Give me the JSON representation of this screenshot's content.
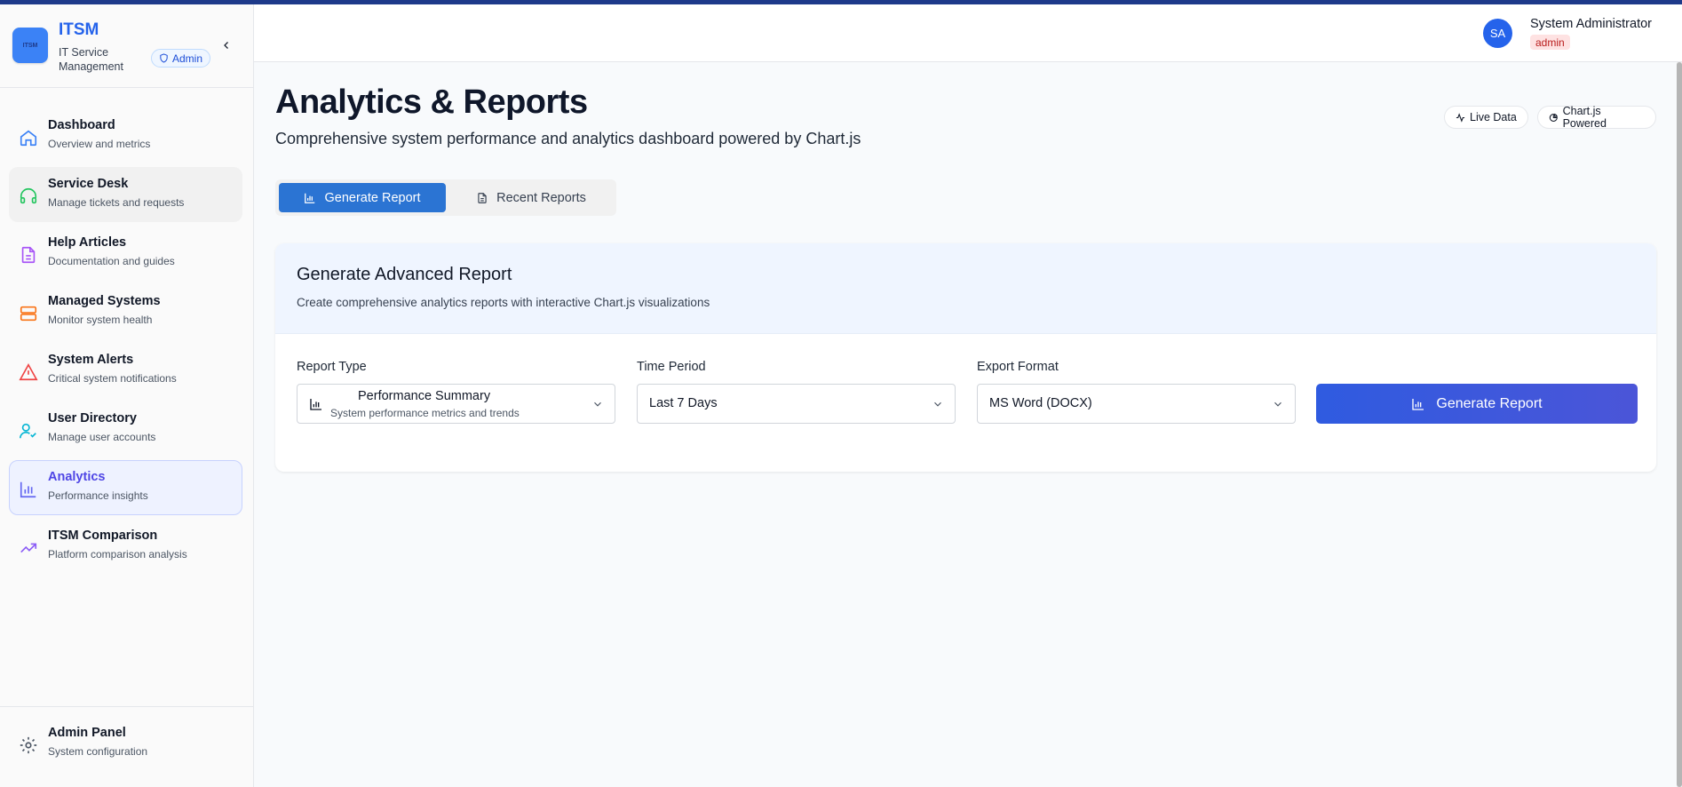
{
  "brand": {
    "logo_text": "ITSM",
    "title": "ITSM",
    "subtitle": "IT Service Management",
    "admin_chip": "Admin"
  },
  "sidebar": {
    "items": [
      {
        "label": "Dashboard",
        "desc": "Overview and metrics",
        "icon": "home-icon",
        "color": "#3b82f6"
      },
      {
        "label": "Service Desk",
        "desc": "Manage tickets and requests",
        "icon": "headset-icon",
        "color": "#22c55e"
      },
      {
        "label": "Help Articles",
        "desc": "Documentation and guides",
        "icon": "document-icon",
        "color": "#a855f7"
      },
      {
        "label": "Managed Systems",
        "desc": "Monitor system health",
        "icon": "server-icon",
        "color": "#f97316"
      },
      {
        "label": "System Alerts",
        "desc": "Critical system notifications",
        "icon": "alert-icon",
        "color": "#ef4444"
      },
      {
        "label": "User Directory",
        "desc": "Manage user accounts",
        "icon": "user-check-icon",
        "color": "#06b6d4"
      },
      {
        "label": "Analytics",
        "desc": "Performance insights",
        "icon": "bar-chart-icon",
        "color": "#6366f1"
      },
      {
        "label": "ITSM Comparison",
        "desc": "Platform comparison analysis",
        "icon": "trending-up-icon",
        "color": "#8b5cf6"
      }
    ],
    "footer": {
      "label": "Admin Panel",
      "desc": "System configuration",
      "icon": "gear-icon"
    }
  },
  "header": {
    "avatar": "SA",
    "user_name": "System Administrator",
    "role": "admin"
  },
  "main": {
    "title": "Analytics & Reports",
    "subtitle": "Comprehensive system performance and analytics dashboard powered by Chart.js",
    "pills": [
      "Live Data",
      "Chart.js Powered"
    ],
    "tabs": [
      "Generate Report",
      "Recent Reports"
    ],
    "card": {
      "title": "Generate Advanced Report",
      "desc": "Create comprehensive analytics reports with interactive Chart.js visualizations",
      "report_type_label": "Report Type",
      "report_type_value": "Performance Summary",
      "report_type_desc": "System performance metrics and trends",
      "time_period_label": "Time Period",
      "time_period_value": "Last 7 Days",
      "export_format_label": "Export Format",
      "export_format_value": "MS Word (DOCX)",
      "button": "Generate Report"
    }
  },
  "colors": {
    "accent": "#2563eb",
    "active_tab": "#2b74d3",
    "role_badge_bg": "#fee2e2",
    "role_badge_text": "#b91c1c"
  }
}
